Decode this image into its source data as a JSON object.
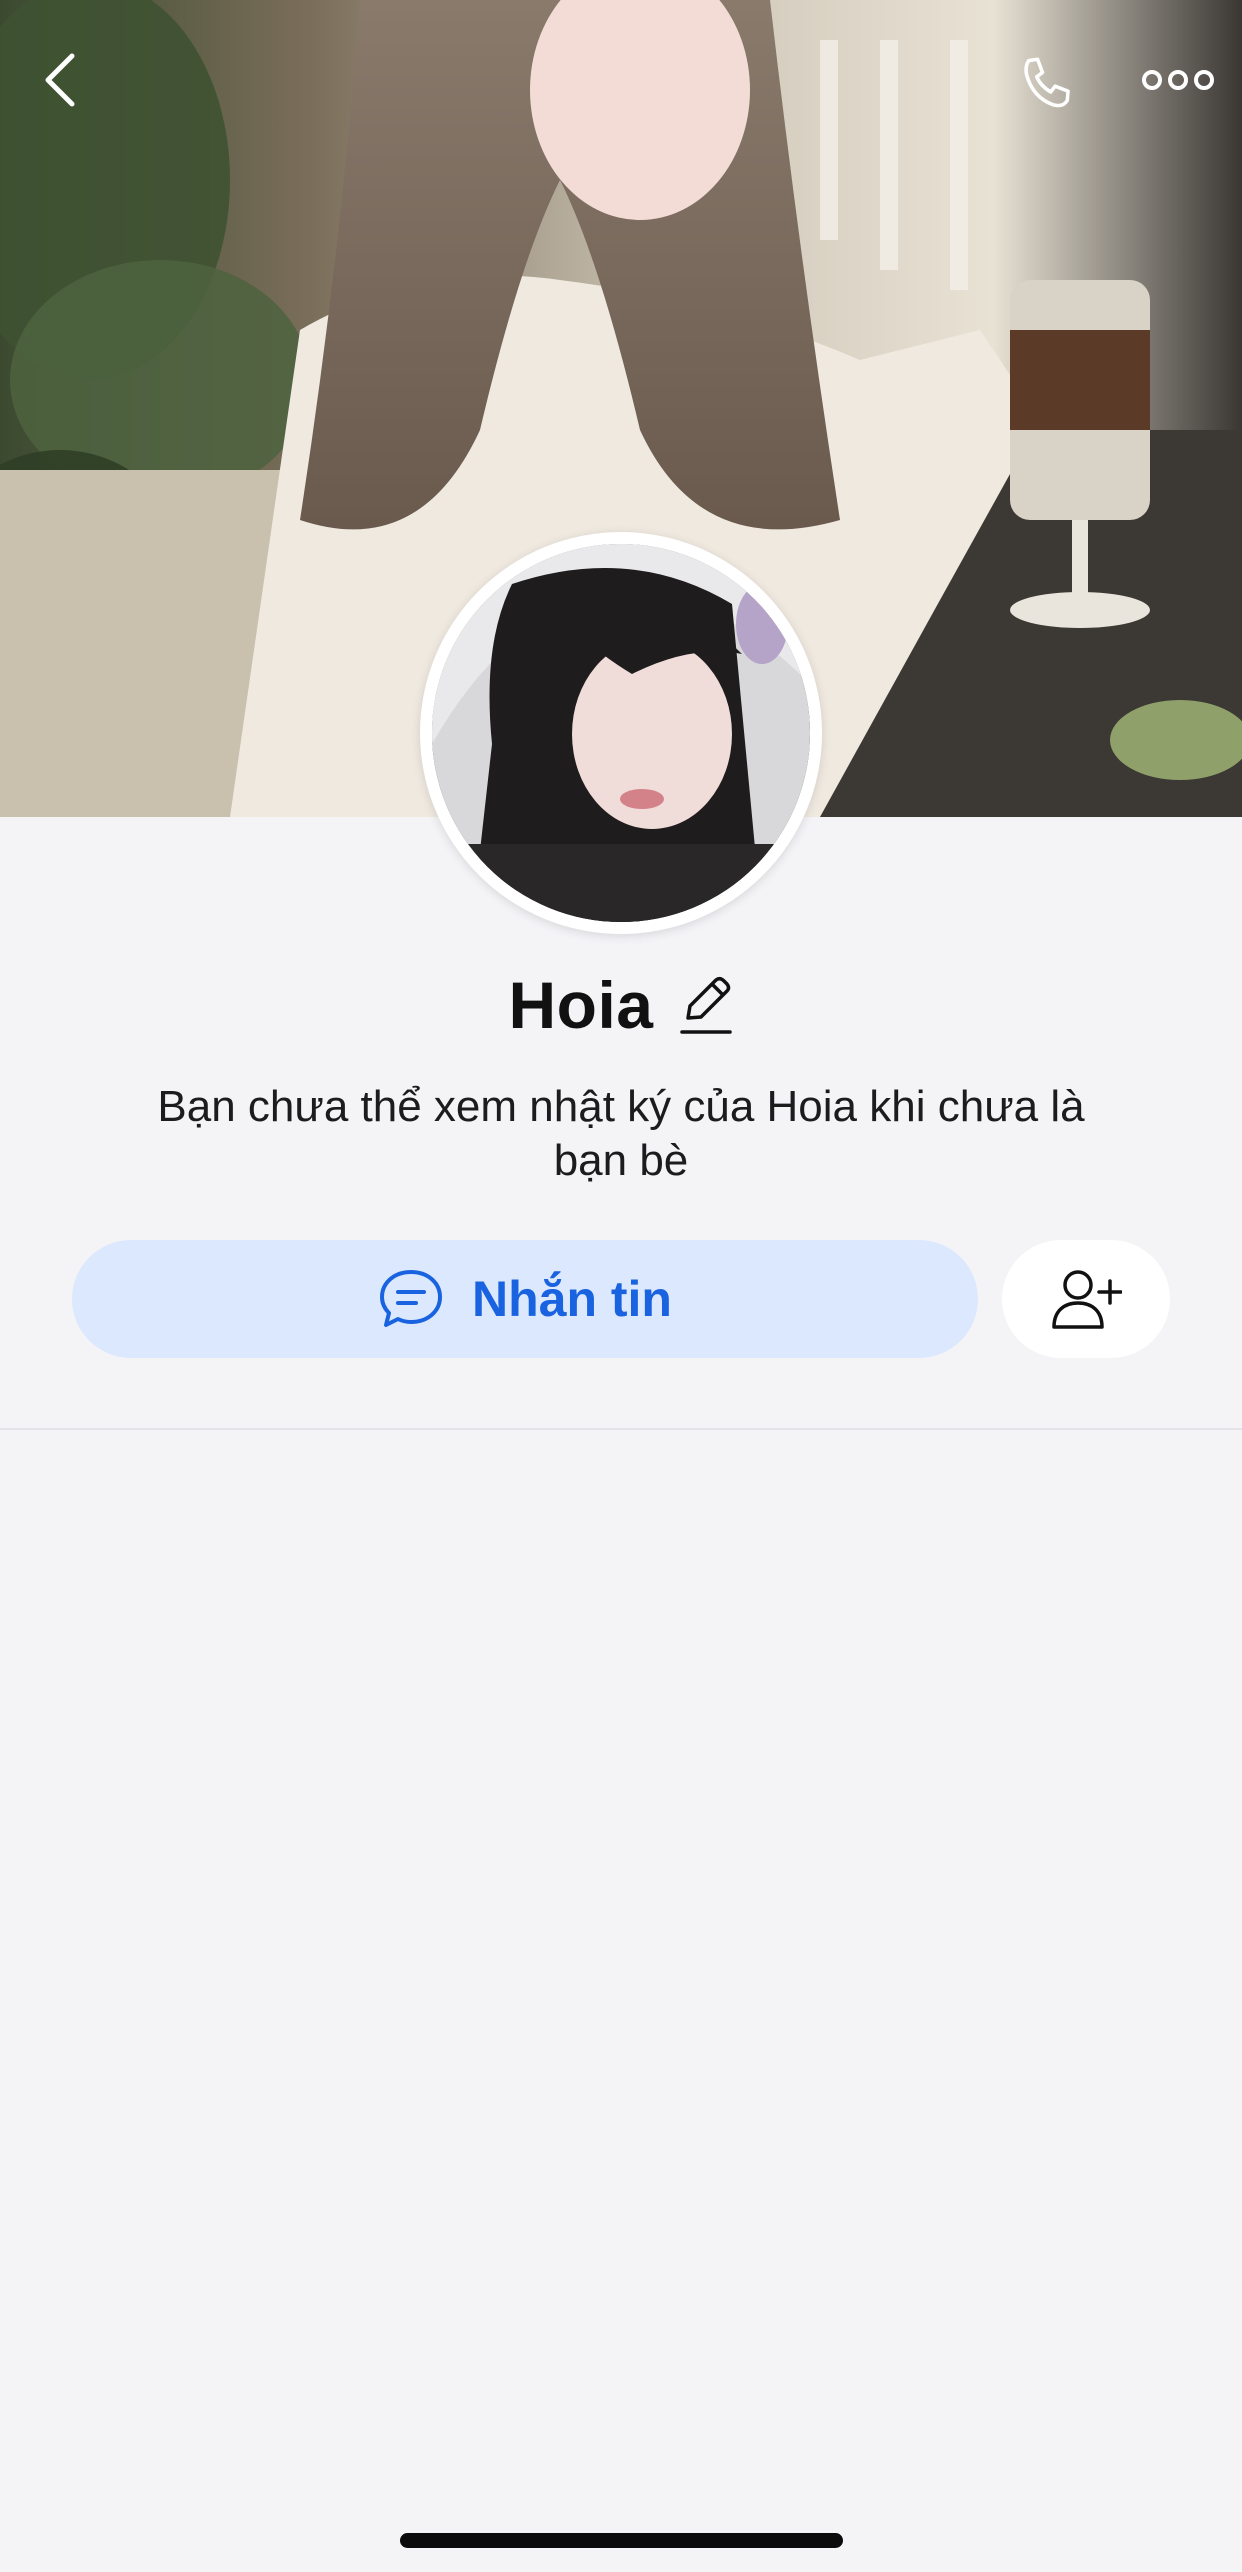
{
  "topbar": {
    "back_icon": "chevron-left-icon",
    "call_icon": "phone-icon",
    "more_icon": "more-dots-icon"
  },
  "profile": {
    "name": "Hoia",
    "edit_icon": "pencil-icon",
    "notice": "Bạn chưa thể xem nhật ký của Hoia khi chưa là bạn bè"
  },
  "actions": {
    "message_label": "Nhắn tin",
    "message_icon": "chat-bubble-icon",
    "add_friend_icon": "add-user-icon"
  },
  "colors": {
    "background": "#f4f4f7",
    "accent": "#1a63e0",
    "message_button_bg": "#dce8fd"
  }
}
